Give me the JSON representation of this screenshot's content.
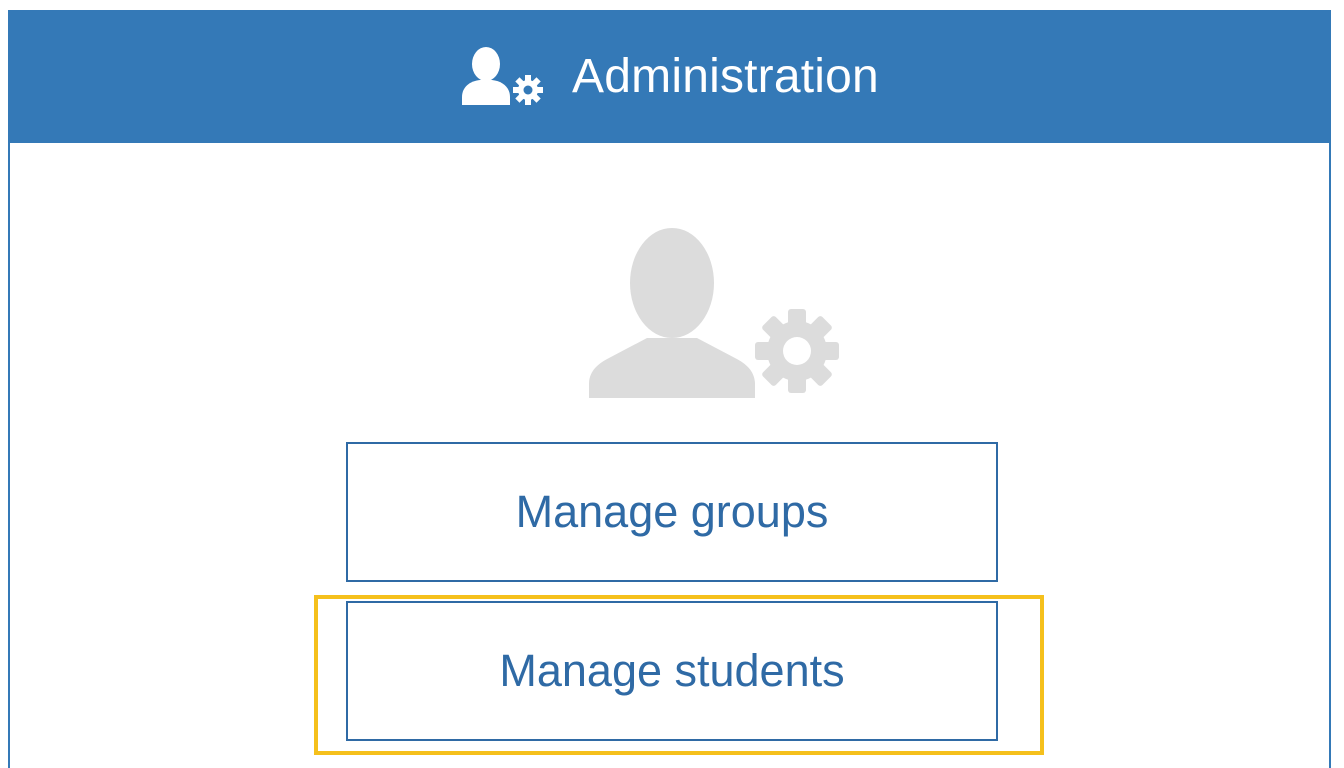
{
  "header": {
    "title": "Administration",
    "icon": "user-gear-icon"
  },
  "illustration": {
    "icon": "user-gear-icon"
  },
  "actions": [
    {
      "label": "Manage groups"
    },
    {
      "label": "Manage students",
      "highlighted": true
    }
  ],
  "colors": {
    "primary": "#3479b7",
    "button_text": "#2f6aa5",
    "illustration": "#dcdcdc",
    "highlight": "#f5c01c"
  }
}
